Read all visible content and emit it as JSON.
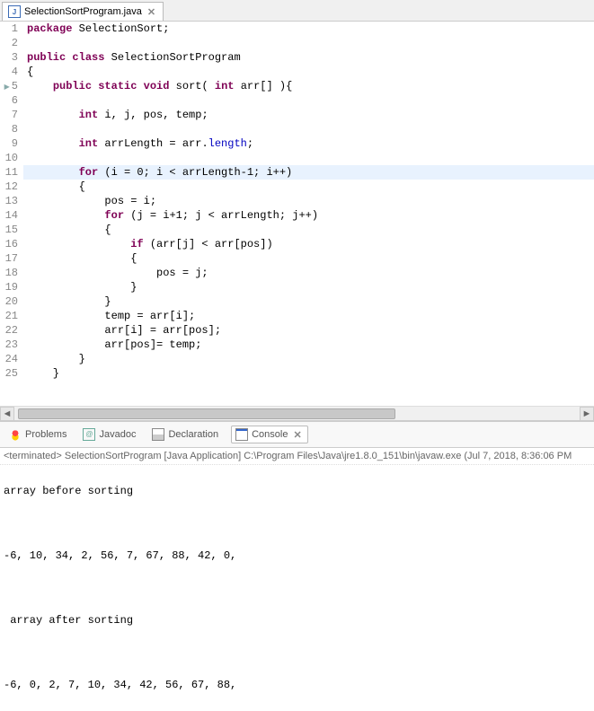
{
  "tab": {
    "filename": "SelectionSortProgram.java",
    "close": "✕"
  },
  "gutter": [
    "1",
    "2",
    "3",
    "4",
    "5",
    "6",
    "7",
    "8",
    "9",
    "10",
    "11",
    "12",
    "13",
    "14",
    "15",
    "16",
    "17",
    "18",
    "19",
    "20",
    "21",
    "22",
    "23",
    "24",
    "25"
  ],
  "code": {
    "l1_kw1": "package",
    "l1_rest": " SelectionSort;",
    "l3_kw1": "public",
    "l3_kw2": "class",
    "l3_rest": " SelectionSortProgram",
    "l4": "{",
    "l5_pad": "    ",
    "l5_kw1": "public",
    "l5_kw2": "static",
    "l5_kw3": "void",
    "l5_mid": " sort( ",
    "l5_kw4": "int",
    "l5_end": " arr[] ){",
    "l7_pad": "        ",
    "l7_kw": "int",
    "l7_rest": " i, j, pos, temp;",
    "l9_pad": "        ",
    "l9_kw": "int",
    "l9_mid": " arrLength = arr.",
    "l9_field": "length",
    "l9_end": ";",
    "l11_pad": "        ",
    "l11_kw": "for",
    "l11_rest": " (i = 0; i < arrLength-1; i++)",
    "l12": "        {",
    "l13": "            pos = i;",
    "l14_pad": "            ",
    "l14_kw": "for",
    "l14_rest": " (j = i+1; j < arrLength; j++)",
    "l15": "            {",
    "l16_pad": "                ",
    "l16_kw": "if",
    "l16_rest": " (arr[j] < arr[pos])",
    "l17": "                {",
    "l18": "                    pos = j;",
    "l19": "                }",
    "l20": "            }",
    "l21": "            temp = arr[i];",
    "l22": "            arr[i] = arr[pos];",
    "l23": "            arr[pos]= temp;",
    "l24": "        }",
    "l25": "    }"
  },
  "lowerTabs": {
    "problems": "Problems",
    "javadoc": "Javadoc",
    "declaration": "Declaration",
    "console": "Console",
    "close": "✕"
  },
  "console": {
    "head_prefix": "<terminated> ",
    "head_rest": "SelectionSortProgram [Java Application] C:\\Program Files\\Java\\jre1.8.0_151\\bin\\javaw.exe (Jul 7, 2018, 8:36:06 PM",
    "line1": "array before sorting",
    "line2": "-6, 10, 34, 2, 56, 7, 67, 88, 42, 0, ",
    "line3": " array after sorting",
    "line4": "-6, 0, 2, 7, 10, 34, 42, 56, 67, 88, "
  }
}
